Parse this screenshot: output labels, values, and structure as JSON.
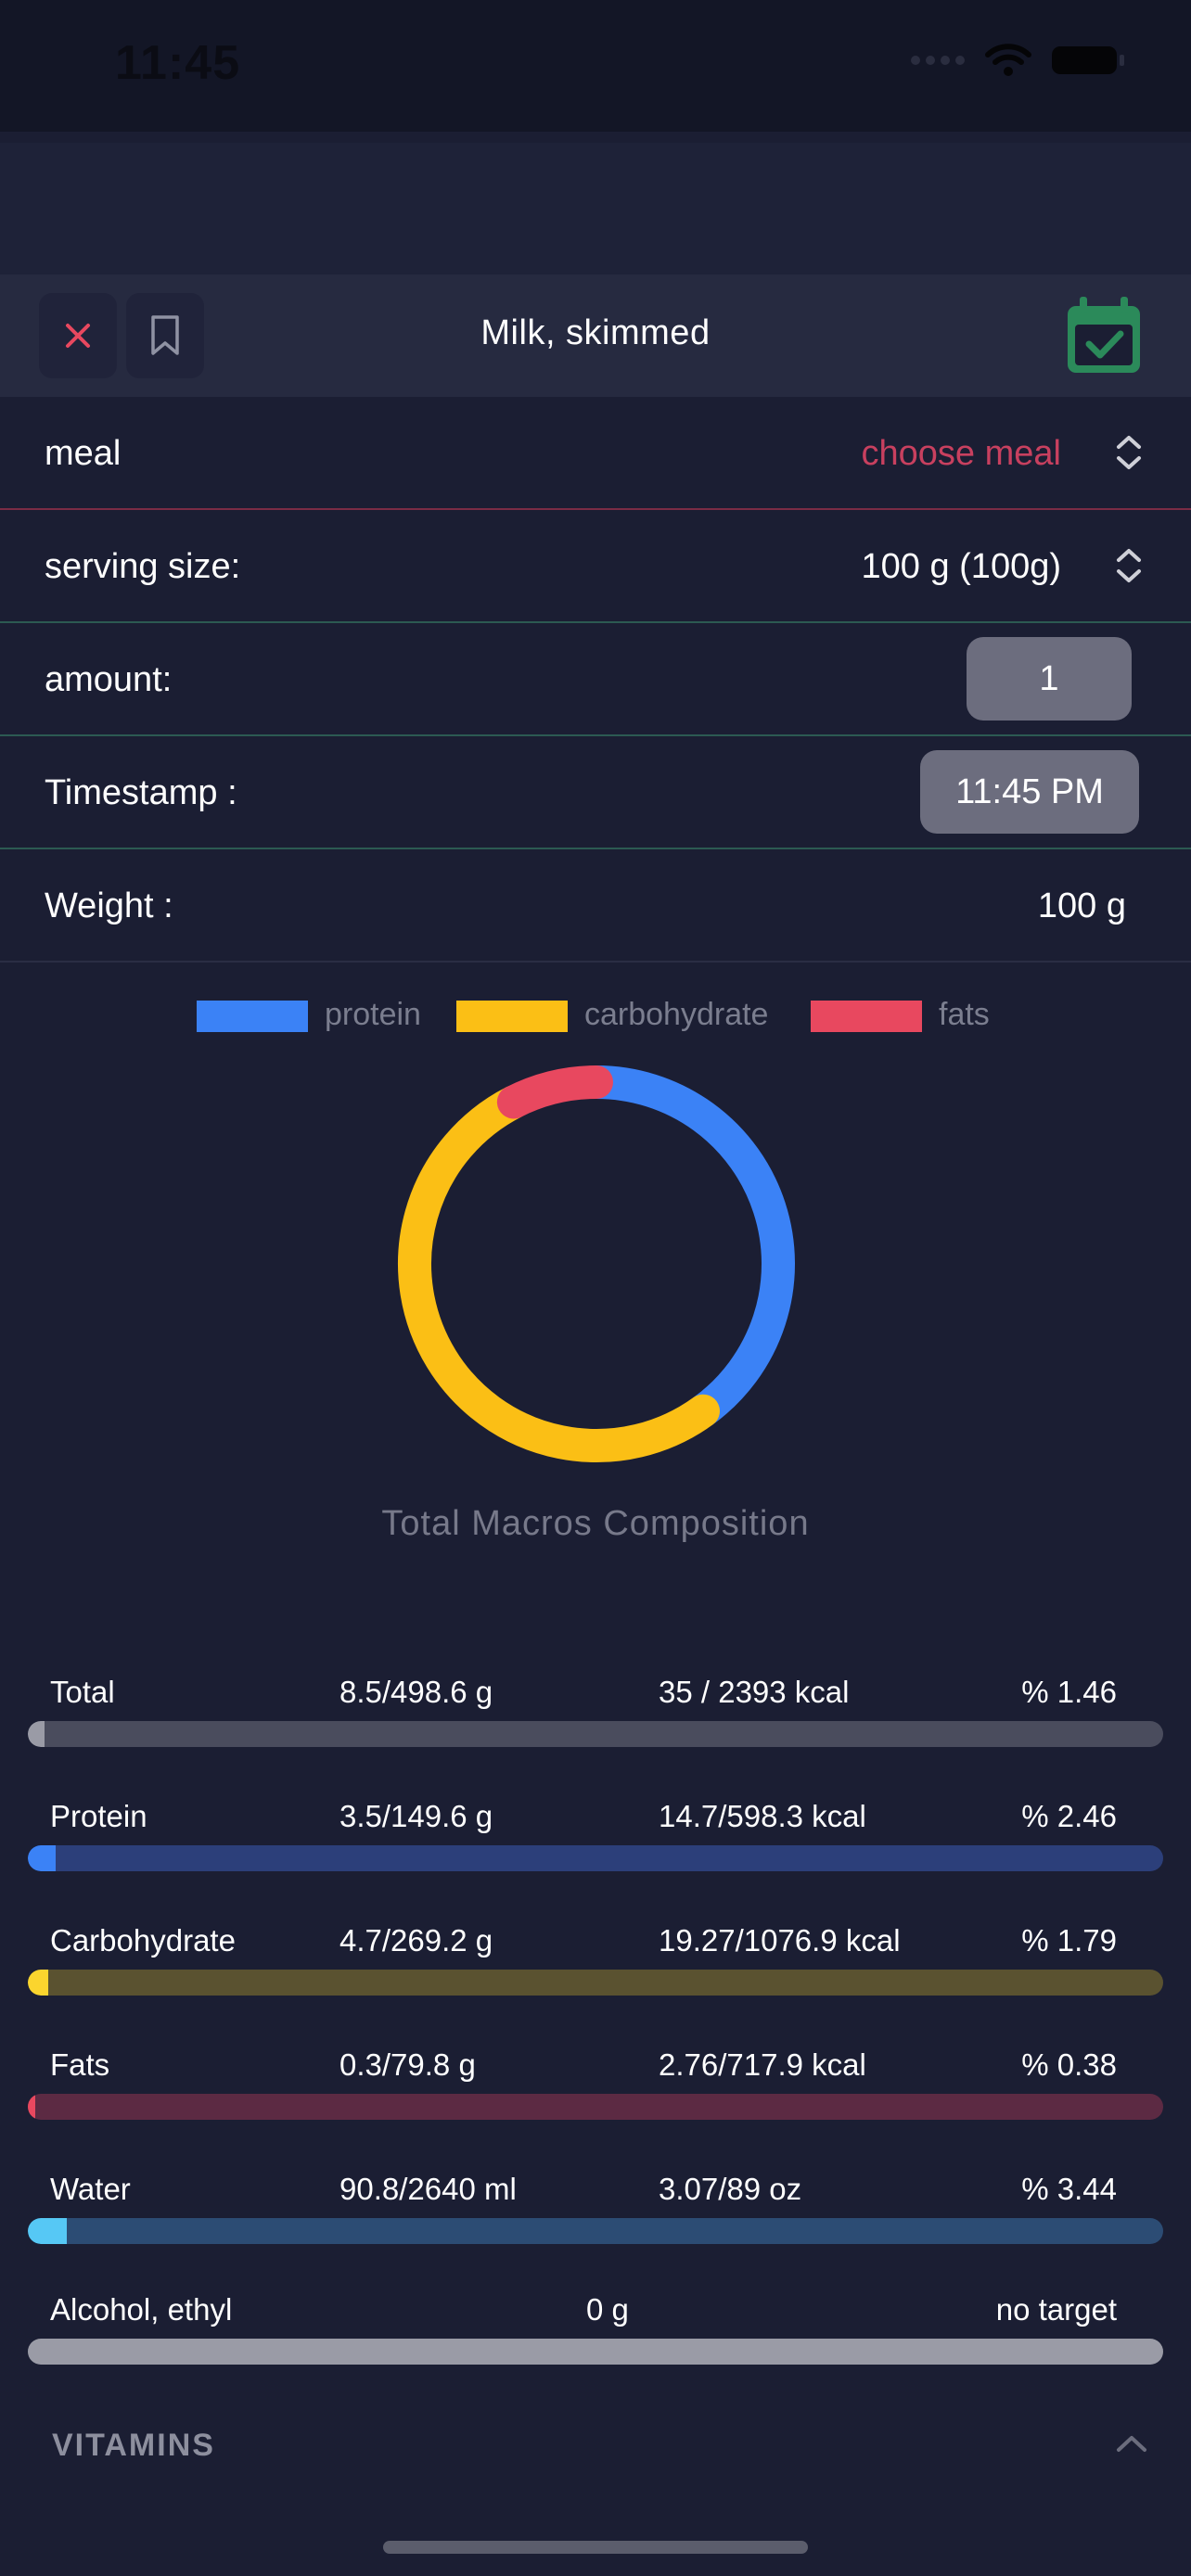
{
  "status_bar": {
    "time": "11:45"
  },
  "header": {
    "title": "Milk, skimmed"
  },
  "rows": {
    "meal": {
      "label": "meal",
      "value": "choose meal"
    },
    "serving": {
      "label": "serving size:",
      "value": "100 g (100g)"
    },
    "amount": {
      "label": "amount:",
      "value": "1"
    },
    "timestamp": {
      "label": "Timestamp :",
      "value": "11:45 PM"
    },
    "weight": {
      "label": "Weight :",
      "value": "100 g"
    }
  },
  "legend": [
    {
      "label": "protein",
      "color": "#3b82f6"
    },
    {
      "label": "carbohydrate",
      "color": "#fbbf15"
    },
    {
      "label": "fats",
      "color": "#e8485f"
    }
  ],
  "chart_data": {
    "type": "pie",
    "title": "Total Macros Composition",
    "categories": [
      "protein",
      "carbohydrate",
      "fats"
    ],
    "values": [
      14.7,
      19.27,
      2.76
    ],
    "colors": [
      "#3b82f6",
      "#fbbf15",
      "#e8485f"
    ]
  },
  "nutrients": [
    {
      "name": "Total",
      "grams": "8.5/498.6 g",
      "kcal": "35 / 2393 kcal",
      "pct": "% 1.46",
      "fraction": 0.0146,
      "bar_color": "#4a4c5d",
      "fill_color": "#9a9ba6"
    },
    {
      "name": "Protein",
      "grams": "3.5/149.6 g",
      "kcal": "14.7/598.3 kcal",
      "pct": "% 2.46",
      "fraction": 0.0246,
      "bar_color": "#2c3f7a",
      "fill_color": "#3b82f6"
    },
    {
      "name": "Carbohydrate",
      "grams": "4.7/269.2 g",
      "kcal": "19.27/1076.9 kcal",
      "pct": "% 1.79",
      "fraction": 0.0179,
      "bar_color": "#5a5230",
      "fill_color": "#fbd52e"
    },
    {
      "name": "Fats",
      "grams": "0.3/79.8 g",
      "kcal": "2.76/717.9 kcal",
      "pct": "% 0.38",
      "fraction": 0.0038,
      "bar_color": "#5c2a43",
      "fill_color": "#e8485f"
    },
    {
      "name": "Water",
      "grams": "90.8/2640 ml",
      "kcal": "3.07/89 oz",
      "pct": "% 3.44",
      "fraction": 0.0344,
      "bar_color": "#2c4c74",
      "fill_color": "#56c8f5"
    }
  ],
  "alcohol": {
    "name": "Alcohol, ethyl",
    "value": "0 g",
    "target": "no target"
  },
  "section": {
    "vitamins": "VITAMINS"
  }
}
